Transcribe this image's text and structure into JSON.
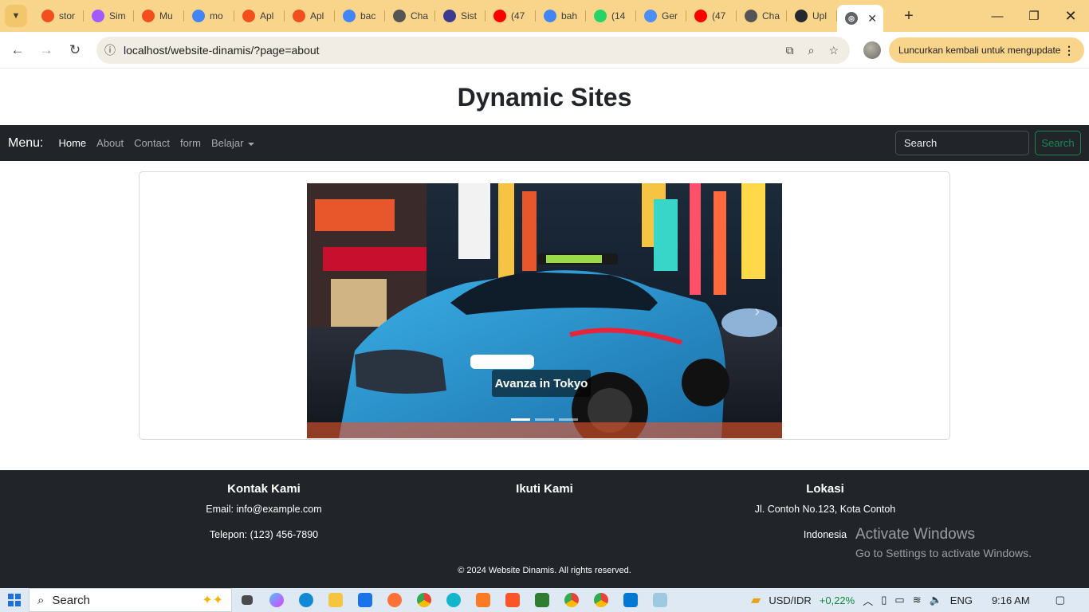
{
  "browser": {
    "tabs": [
      {
        "label": "stor",
        "icon": "figma-icon",
        "color": "#f24e1e"
      },
      {
        "label": "Sim",
        "icon": "figma-icon",
        "color": "#a259ff"
      },
      {
        "label": "Mu",
        "icon": "figma-icon",
        "color": "#f24e1e"
      },
      {
        "label": "mo",
        "icon": "google-icon",
        "color": "#4285f4"
      },
      {
        "label": "Apl",
        "icon": "figma-icon",
        "color": "#f24e1e"
      },
      {
        "label": "Apl",
        "icon": "figma-icon",
        "color": "#f24e1e"
      },
      {
        "label": "bac",
        "icon": "google-icon",
        "color": "#4285f4"
      },
      {
        "label": "Cha",
        "icon": "chatgpt-icon",
        "color": "#555555"
      },
      {
        "label": "Sist",
        "icon": "university-icon",
        "color": "#3b3b8f"
      },
      {
        "label": "(47",
        "icon": "youtube-icon",
        "color": "#ff0000"
      },
      {
        "label": "bah",
        "icon": "google-icon",
        "color": "#4285f4"
      },
      {
        "label": "(14",
        "icon": "whatsapp-icon",
        "color": "#25d366"
      },
      {
        "label": "Ger",
        "icon": "gemini-icon",
        "color": "#4c8df6"
      },
      {
        "label": "(47",
        "icon": "youtube-icon",
        "color": "#ff0000"
      },
      {
        "label": "Cha",
        "icon": "chatgpt-icon",
        "color": "#555555"
      },
      {
        "label": "Upl",
        "icon": "github-icon",
        "color": "#24292f"
      }
    ],
    "active_tab_icon": "globe-icon",
    "url": "localhost/website-dinamis/?page=about",
    "update_label": "Luncurkan kembali untuk mengupdate"
  },
  "site": {
    "title": "Dynamic Sites",
    "menu_label": "Menu:",
    "nav": [
      "Home",
      "About",
      "Contact",
      "form",
      "Belajar"
    ],
    "search_placeholder": "Search",
    "search_button": "Search",
    "carousel_caption": "Avanza in Tokyo",
    "carousel_slides": 3,
    "carousel_active_slide": 1
  },
  "footer": {
    "contact": {
      "heading": "Kontak Kami",
      "email": "Email: info@example.com",
      "phone": "Telepon: (123) 456-7890"
    },
    "follow": {
      "heading": "Ikuti Kami"
    },
    "location": {
      "heading": "Lokasi",
      "address": "Jl. Contoh No.123, Kota Contoh",
      "country": "Indonesia"
    },
    "copyright": "© 2024 Website Dinamis. All rights reserved."
  },
  "watermark": {
    "line1": "Activate Windows",
    "line2": "Go to Settings to activate Windows."
  },
  "taskbar": {
    "search_label": "Search",
    "ticker": "USD/IDR",
    "ticker_change": "+0,22%",
    "lang": "ENG",
    "time": "9:16 AM"
  }
}
